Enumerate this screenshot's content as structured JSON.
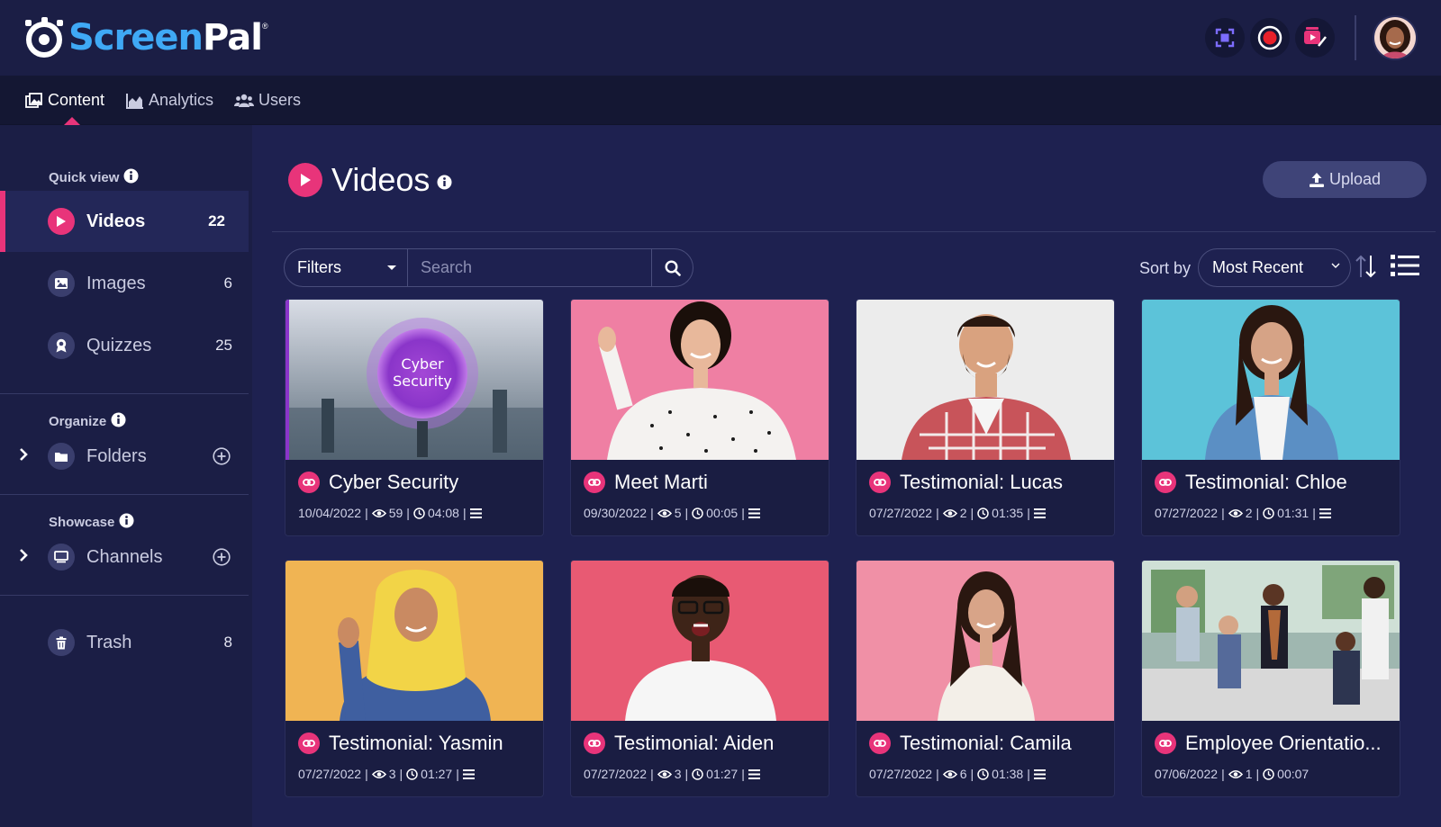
{
  "app": {
    "logo_text_a": "Screen",
    "logo_text_b": "Pal",
    "logo_reg": "®"
  },
  "nav": {
    "items": [
      {
        "label": "Content",
        "icon": "gallery-icon"
      },
      {
        "label": "Analytics",
        "icon": "area-chart-icon"
      },
      {
        "label": "Users",
        "icon": "users-icon"
      }
    ]
  },
  "sidebar": {
    "quick_view_label": "Quick view",
    "organize_label": "Organize",
    "showcase_label": "Showcase",
    "items": [
      {
        "label": "Videos",
        "count": "22"
      },
      {
        "label": "Images",
        "count": "6"
      },
      {
        "label": "Quizzes",
        "count": "25"
      },
      {
        "label": "Folders"
      },
      {
        "label": "Channels"
      },
      {
        "label": "Trash",
        "count": "8"
      }
    ]
  },
  "main": {
    "title": "Videos",
    "upload_label": "Upload",
    "filters_label": "Filters",
    "search_placeholder": "Search",
    "sort_label": "Sort by",
    "sort_value": "Most Recent"
  },
  "cards": [
    {
      "title": "Cyber Security",
      "date": "10/04/2022",
      "views": "59",
      "duration": "04:08",
      "has_list": true,
      "thumb_text_1": "Cyber",
      "thumb_text_2": "Security"
    },
    {
      "title": "Meet Marti",
      "date": "09/30/2022",
      "views": "5",
      "duration": "00:05",
      "has_list": true
    },
    {
      "title": "Testimonial: Lucas",
      "date": "07/27/2022",
      "views": "2",
      "duration": "01:35",
      "has_list": true
    },
    {
      "title": "Testimonial: Chloe",
      "date": "07/27/2022",
      "views": "2",
      "duration": "01:31",
      "has_list": true
    },
    {
      "title": "Testimonial: Yasmin",
      "date": "07/27/2022",
      "views": "3",
      "duration": "01:27",
      "has_list": true
    },
    {
      "title": "Testimonial: Aiden",
      "date": "07/27/2022",
      "views": "3",
      "duration": "01:27",
      "has_list": true
    },
    {
      "title": "Testimonial: Camila",
      "date": "07/27/2022",
      "views": "6",
      "duration": "01:38",
      "has_list": true
    },
    {
      "title": "Employee Orientatio...",
      "date": "07/06/2022",
      "views": "1",
      "duration": "00:07",
      "has_list": false
    }
  ],
  "colors": {
    "accent": "#e8347a",
    "brand_blue": "#3fa9f5",
    "bg": "#1e2150",
    "panel": "#1b1e45"
  }
}
